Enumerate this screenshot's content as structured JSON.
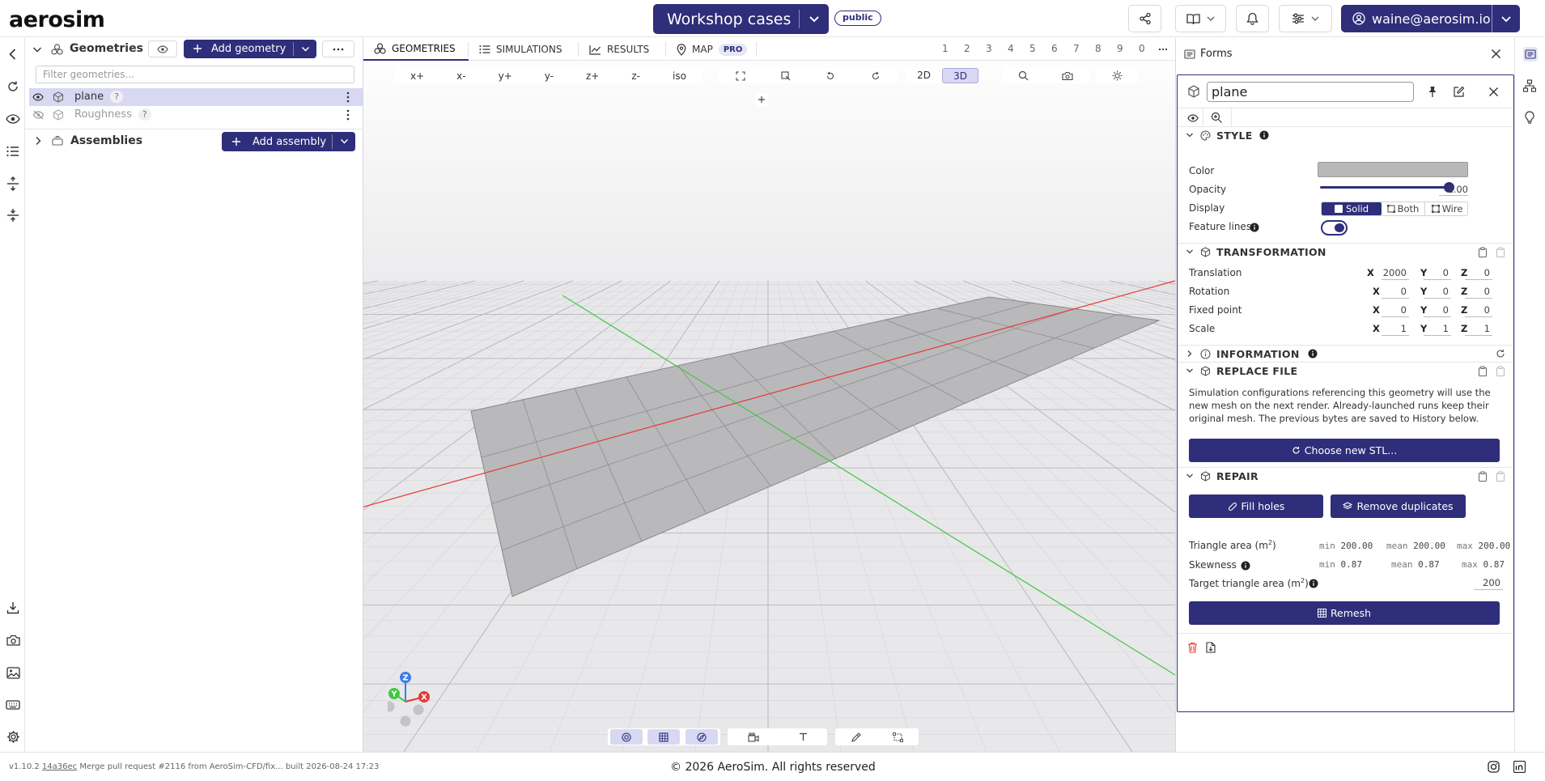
{
  "app": {
    "logo": "aerosim"
  },
  "header": {
    "project_title": "Workshop cases",
    "visibility_badge": "public",
    "user_email": "waine@aerosim.io"
  },
  "geometries": {
    "title": "Geometries",
    "add_button": "Add geometry",
    "filter_placeholder": "Filter geometries...",
    "items": [
      {
        "name": "plane",
        "badge": "?",
        "visible": true,
        "selected": true
      },
      {
        "name": "Roughness",
        "badge": "?",
        "visible": false,
        "selected": false
      }
    ],
    "assemblies": {
      "title": "Assemblies",
      "add_button": "Add assembly"
    }
  },
  "viewport_tabs": [
    {
      "label": "GEOMETRIES",
      "icon": "geometries-icon",
      "active": true
    },
    {
      "label": "SIMULATIONS",
      "icon": "list-icon",
      "active": false
    },
    {
      "label": "RESULTS",
      "icon": "chart-icon",
      "active": false
    },
    {
      "label": "MAP",
      "icon": "map-pin-icon",
      "active": false,
      "badge": "PRO"
    }
  ],
  "camera_slots": [
    "1",
    "2",
    "3",
    "4",
    "5",
    "6",
    "7",
    "8",
    "9",
    "0"
  ],
  "view_buttons": [
    "x+",
    "x-",
    "y+",
    "y-",
    "z+",
    "z-",
    "iso"
  ],
  "projection": {
    "options": [
      "2D",
      "3D"
    ],
    "selected": "3D"
  },
  "axis_labels": {
    "z": "Z",
    "y": "Y",
    "x": "X"
  },
  "forms": {
    "title": "Forms",
    "object_name": "plane",
    "style": {
      "title": "STYLE",
      "color_label": "Color",
      "color_value": "#b8b8b8",
      "opacity_label": "Opacity",
      "opacity_value": "1.00",
      "opacity_fraction": 1.0,
      "display_label": "Display",
      "display_options": [
        "Solid",
        "Both",
        "Wire"
      ],
      "display_selected": "Solid",
      "feature_lines_label": "Feature lines",
      "feature_lines_on": true
    },
    "transformation": {
      "title": "TRANSFORMATION",
      "rows": [
        {
          "label": "Translation",
          "x": "2000",
          "y": "0",
          "z": "0"
        },
        {
          "label": "Rotation",
          "x": "0",
          "y": "0",
          "z": "0"
        },
        {
          "label": "Fixed point",
          "x": "0",
          "y": "0",
          "z": "0"
        },
        {
          "label": "Scale",
          "x": "1",
          "y": "1",
          "z": "1"
        }
      ]
    },
    "information": {
      "title": "INFORMATION"
    },
    "replace_file": {
      "title": "REPLACE FILE",
      "description": "Simulation configurations referencing this geometry will use the new mesh on the next render. Already-launched runs keep their original mesh. The previous bytes are saved to History below.",
      "button": "Choose new STL..."
    },
    "repair": {
      "title": "REPAIR",
      "fill_holes": "Fill holes",
      "remove_duplicates": "Remove duplicates",
      "triangle_area_label": "Triangle area (m",
      "triangle_area_sup": "2",
      "triangle_area_close": ")",
      "triangle_area": {
        "min": "200.00",
        "mean": "200.00",
        "max": "200.00"
      },
      "skewness_label": "Skewness",
      "skewness": {
        "min": "0.87",
        "mean": "0.87",
        "max": "0.87"
      },
      "stat_labels": {
        "min": "min",
        "mean": "mean",
        "max": "max"
      },
      "target_label": "Target triangle area (m",
      "target_sup": "2",
      "target_close": ")",
      "target_value": "200",
      "remesh": "Remesh"
    }
  },
  "footer": {
    "version": "v1.10.2",
    "commit": "14a36ec",
    "commit_message": "Merge pull request #2116 from AeroSim-CFD/fix...",
    "built": "built 2026-08-24 17:23",
    "copyright": "© 2026 AeroSim. All rights reserved"
  },
  "colors": {
    "primary": "#2e2e7a",
    "x_axis": "#e53935",
    "y_axis": "#43c73f",
    "z_axis": "#3b7ce6"
  }
}
